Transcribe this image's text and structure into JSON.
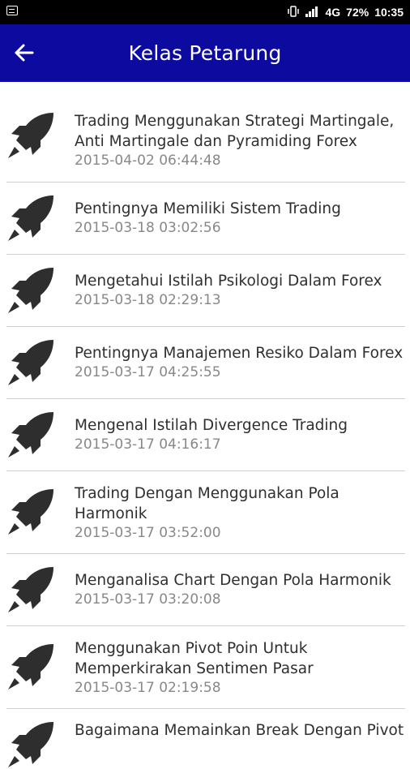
{
  "statusbar": {
    "network": "4G",
    "battery": "72%",
    "time": "10:35"
  },
  "appbar": {
    "title": "Kelas Petarung",
    "back_icon": "arrow-left-icon"
  },
  "items": [
    {
      "title": "Trading Menggunakan Strategi Martingale, Anti Martingale dan Pyramiding Forex",
      "date": "2015-04-02 06:44:48"
    },
    {
      "title": "Pentingnya Memiliki Sistem Trading",
      "date": "2015-03-18 03:02:56"
    },
    {
      "title": "Mengetahui Istilah Psikologi Dalam Forex",
      "date": "2015-03-18 02:29:13"
    },
    {
      "title": "Pentingnya Manajemen Resiko Dalam Forex",
      "date": "2015-03-17 04:25:55"
    },
    {
      "title": "Mengenal Istilah Divergence Trading",
      "date": "2015-03-17 04:16:17"
    },
    {
      "title": "Trading Dengan Menggunakan Pola Harmonik",
      "date": "2015-03-17 03:52:00"
    },
    {
      "title": "Menganalisa Chart Dengan Pola Harmonik",
      "date": "2015-03-17 03:20:08"
    },
    {
      "title": "Menggunakan Pivot Poin Untuk Memperkirakan Sentimen Pasar",
      "date": "2015-03-17 02:19:58"
    },
    {
      "title": "Bagaimana Memainkan Break Dengan Pivot",
      "date": ""
    }
  ]
}
